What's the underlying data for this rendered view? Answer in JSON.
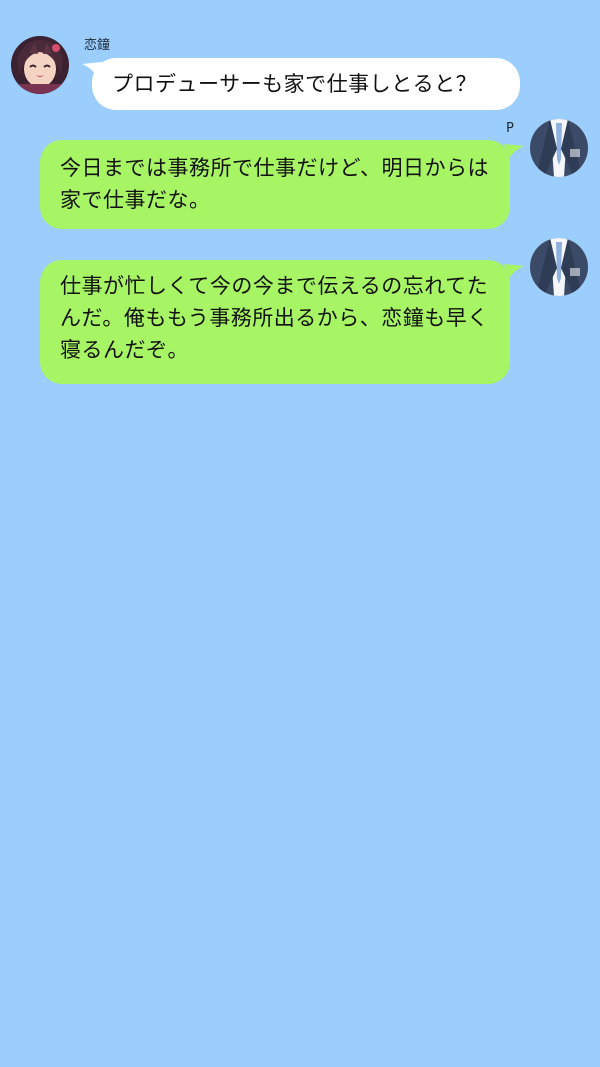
{
  "chat": {
    "messages": [
      {
        "sender": "恋鐘",
        "side": "left",
        "text": "プロデューサーも家で仕事しとると？"
      },
      {
        "sender": "P",
        "side": "right",
        "text": "今日までは事務所で仕事だけど、明日からは家で仕事だな。"
      },
      {
        "sender": "",
        "side": "right",
        "text": "仕事が忙しくて今の今まで伝えるの忘れてたんだ。俺ももう事務所出るから、恋鐘も早く寝るんだぞ。"
      }
    ]
  },
  "colors": {
    "background": "#9bcdfd",
    "incoming_bubble": "#ffffff",
    "outgoing_bubble": "#a7f564"
  },
  "icons": {
    "incoming_avatar": "character-avatar-icon",
    "outgoing_avatar": "suit-avatar-icon"
  }
}
